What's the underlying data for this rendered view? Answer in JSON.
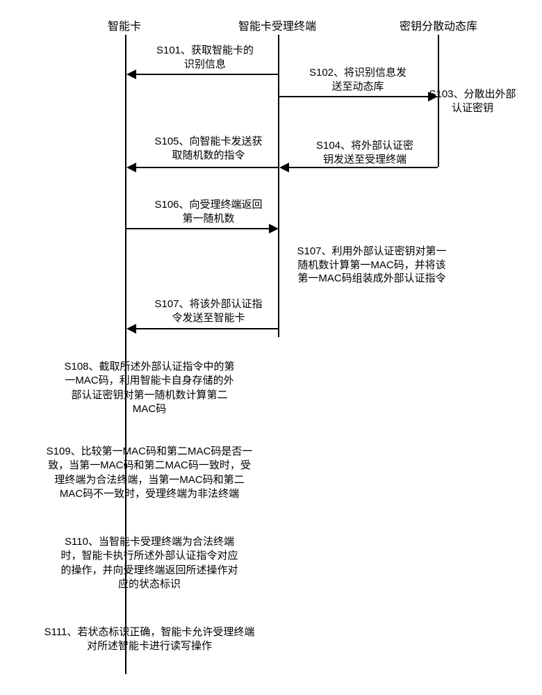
{
  "participants": {
    "smartcard": "智能卡",
    "terminal": "智能卡受理终端",
    "library": "密钥分散动态库"
  },
  "messages": {
    "s101": "S101、获取智能卡的\n识别信息",
    "s102": "S102、将识别信息发\n送至动态库",
    "s103": "S103、分散出外部\n认证密钥",
    "s104": "S104、将外部认证密\n钥发送至受理终端",
    "s105": "S105、向智能卡发送获\n取随机数的指令",
    "s106": "S106、向受理终端返回\n第一随机数",
    "s107a": "S107、利用外部认证密钥对第一\n随机数计算第一MAC码，并将该\n第一MAC码组装成外部认证指令",
    "s107b": "S107、将该外部认证指\n令发送至智能卡",
    "s108": "S108、截取所述外部认证指令中的第\n一MAC码，利用智能卡自身存储的外\n部认证密钥对第一随机数计算第二\nMAC码",
    "s109": "S109、比较第一MAC码和第二MAC码是否一\n致，当第一MAC码和第二MAC码一致时，受\n理终端为合法终端，当第一MAC码和第二\nMAC码不一致时，受理终端为非法终端",
    "s110": "S110、当智能卡受理终端为合法终端\n时，智能卡执行所述外部认证指令对应\n的操作，并向受理终端返回所述操作对\n应的状态标识",
    "s111": "S111、若状态标识正确，智能卡允许受理终端\n对所述智能卡进行读写操作"
  }
}
